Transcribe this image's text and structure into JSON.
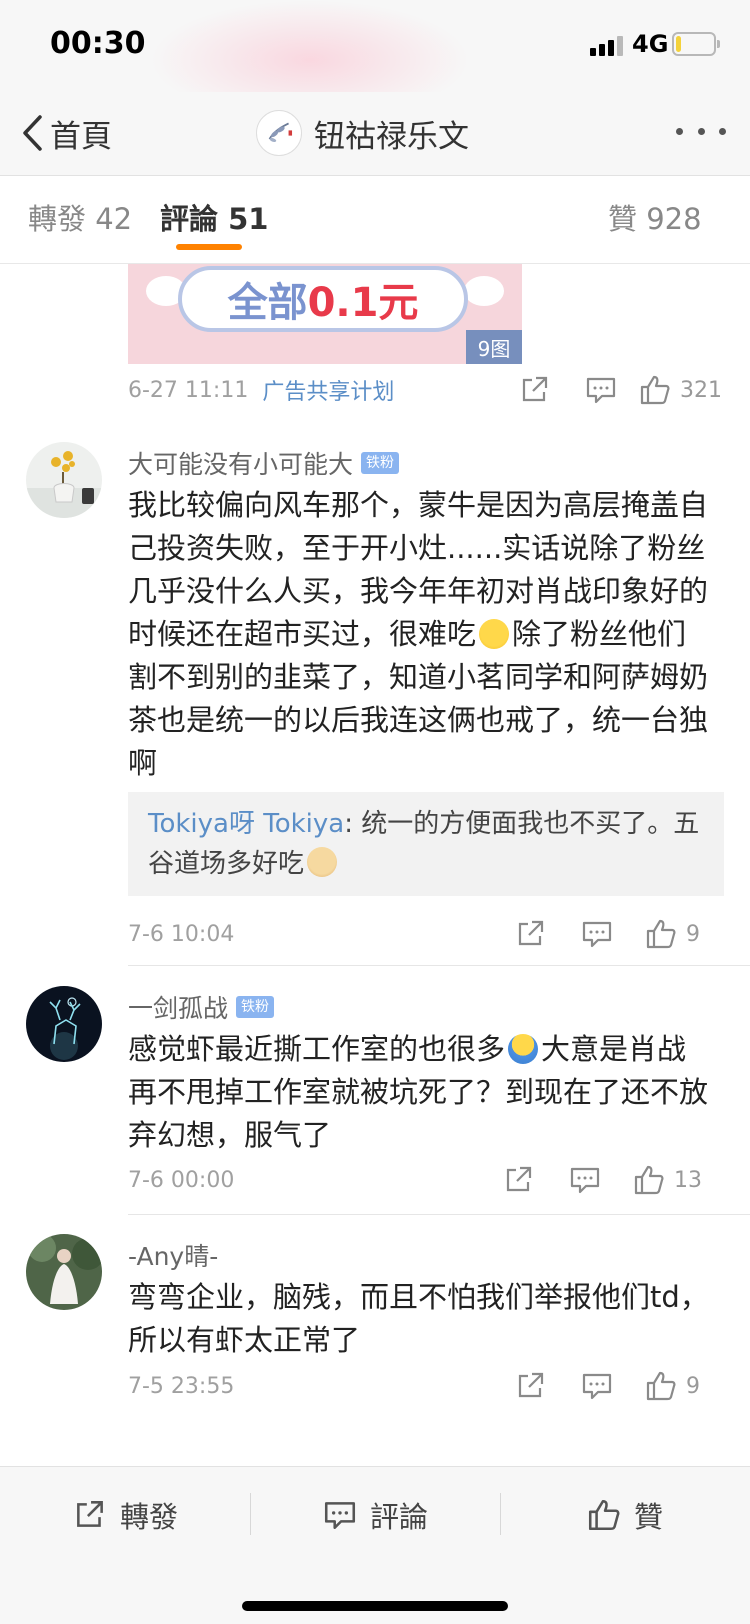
{
  "status_bar": {
    "time": "00:30",
    "network": "4G",
    "battery_level": 0.15,
    "colors": {
      "battery_fill": "#f4d23b"
    }
  },
  "nav": {
    "back_label": "首頁",
    "title": "钮祜禄乐文",
    "icons": {
      "back": "chevron-left-icon",
      "more": "more-dots-icon"
    }
  },
  "tabs": [
    {
      "label": "轉發",
      "count": "42",
      "active": false
    },
    {
      "label": "評論",
      "count": "51",
      "active": true
    },
    {
      "label": "贊",
      "count": "928",
      "active": false
    }
  ],
  "colors": {
    "accent": "#ff8200",
    "link": "#5b8ec7",
    "fan_badge": "#8ab4f0",
    "reply_bg": "#f2f2f2"
  },
  "top_post": {
    "image_text_a": "全部",
    "image_text_b": "0.1元",
    "image_badge": "9图",
    "timestamp": "6-27 11:11",
    "ad_label": "广告共享计划",
    "like_count": "321"
  },
  "comments": [
    {
      "username": "大可能没有小可能大",
      "fan_badge": "铁粉",
      "text_parts": [
        "我比较偏向风车那个，蒙牛是因为高层掩盖自己投资失败，至于开小灶......实话说除了粉丝几乎没什么人买，我今年年初对肖战印象好的时候还在超市买过，很难吃",
        "除了粉丝他们割不到别的韭菜了，知道小茗同学和阿萨姆奶茶也是统一的以后我连这俩也戒了，统一台独啊"
      ],
      "reply": {
        "name": "Tokiya呀 Tokiya",
        "text": ": 统一的方便面我也不买了。五谷道场多好吃"
      },
      "timestamp": "7-6 10:04",
      "like_count": "9"
    },
    {
      "username": "一剑孤战",
      "fan_badge": "铁粉",
      "text_parts": [
        "感觉虾最近撕工作室的也很多",
        "大意是肖战再不甩掉工作室就被坑死了？到现在了还不放弃幻想，服气了"
      ],
      "timestamp": "7-6 00:00",
      "like_count": "13"
    },
    {
      "username": "-Any晴-",
      "text_parts": [
        "弯弯企业，脑残，而且不怕我们举报他们td，所以有虾太正常了"
      ],
      "timestamp": "7-5 23:55",
      "like_count": "9"
    }
  ],
  "bottom_bar": {
    "repost_label": "轉發",
    "comment_label": "評論",
    "like_label": "贊"
  }
}
